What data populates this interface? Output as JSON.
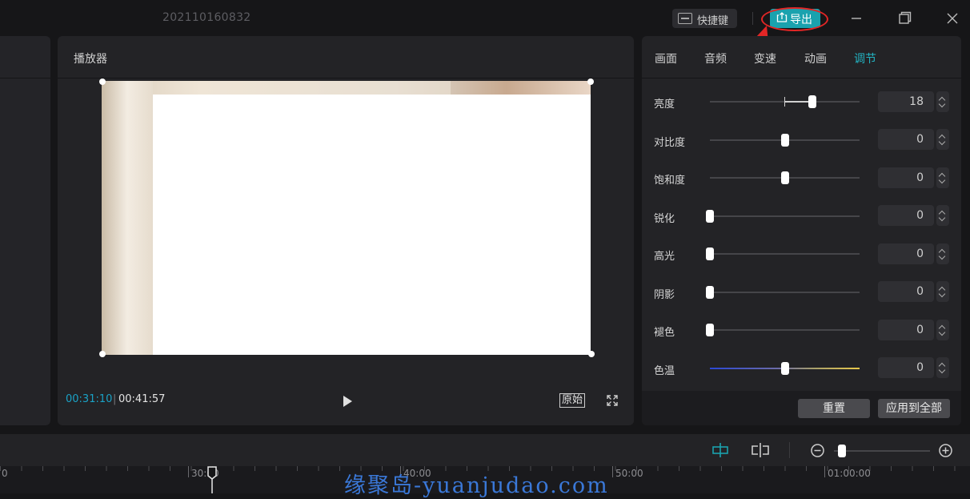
{
  "titlebar": {
    "project_name": "202110160832",
    "shortcut_label": "快捷键",
    "export_label": "导出"
  },
  "player": {
    "title": "播放器",
    "current_time": "00:31:10",
    "separator": "|",
    "total_time": "00:41:57",
    "original_label": "原始"
  },
  "adjust_panel": {
    "tabs": [
      "画面",
      "音频",
      "变速",
      "动画",
      "调节"
    ],
    "active_tab": "调节",
    "rows": [
      {
        "label": "亮度",
        "value": "18"
      },
      {
        "label": "对比度",
        "value": "0"
      },
      {
        "label": "饱和度",
        "value": "0"
      },
      {
        "label": "锐化",
        "value": "0"
      },
      {
        "label": "高光",
        "value": "0"
      },
      {
        "label": "阴影",
        "value": "0"
      },
      {
        "label": "褪色",
        "value": "0"
      },
      {
        "label": "色温",
        "value": "0"
      }
    ],
    "reset_label": "重置",
    "apply_all_label": "应用到全部"
  },
  "timeline": {
    "ruler_labels": [
      "0",
      "30:00",
      "40:00",
      "50:00",
      "01:00:00"
    ]
  },
  "watermark": "缘聚岛-yuanjudao.com",
  "colors": {
    "accent": "#1aa2ae",
    "annotation_red": "#e32626",
    "timecode_blue": "#1aa2c6"
  }
}
